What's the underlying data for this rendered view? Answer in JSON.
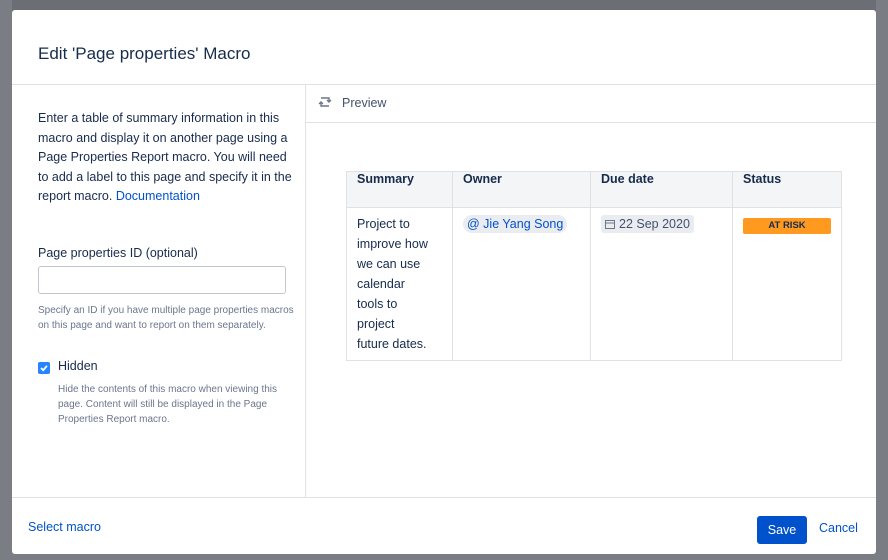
{
  "dialog": {
    "title": "Edit 'Page properties' Macro"
  },
  "left": {
    "description": "Enter a table of summary information in this macro and display it on another page using a Page Properties Report macro. You will need to add a label to this page and specify it in the report macro.",
    "documentation_link": "Documentation",
    "id_label": "Page properties ID (optional)",
    "id_value": "",
    "id_help": "Specify an ID if you have multiple page properties macros on this page and want to report on them separately.",
    "hidden_label": "Hidden",
    "hidden_checked": true,
    "hidden_help": "Hide the contents of this macro when viewing this page. Content will still be displayed in the Page Properties Report macro."
  },
  "preview": {
    "label": "Preview",
    "table": {
      "headers": [
        "Summary",
        "Owner",
        "Due date",
        "Status"
      ],
      "summary_lines": [
        "Project to",
        "improve how",
        "we can use",
        "calendar",
        "tools to",
        "project",
        "future dates."
      ],
      "owner": "@ Jie Yang Song",
      "due_date": "22 Sep 2020",
      "status": "AT RISK"
    }
  },
  "footer": {
    "select_macro": "Select macro",
    "save": "Save",
    "cancel": "Cancel"
  },
  "colors": {
    "accent": "#0052cc",
    "status_at_risk": "#ff991f",
    "checkbox": "#2684ff"
  },
  "icons": [
    "refresh-icon",
    "calendar-icon",
    "checkbox-check-icon"
  ]
}
